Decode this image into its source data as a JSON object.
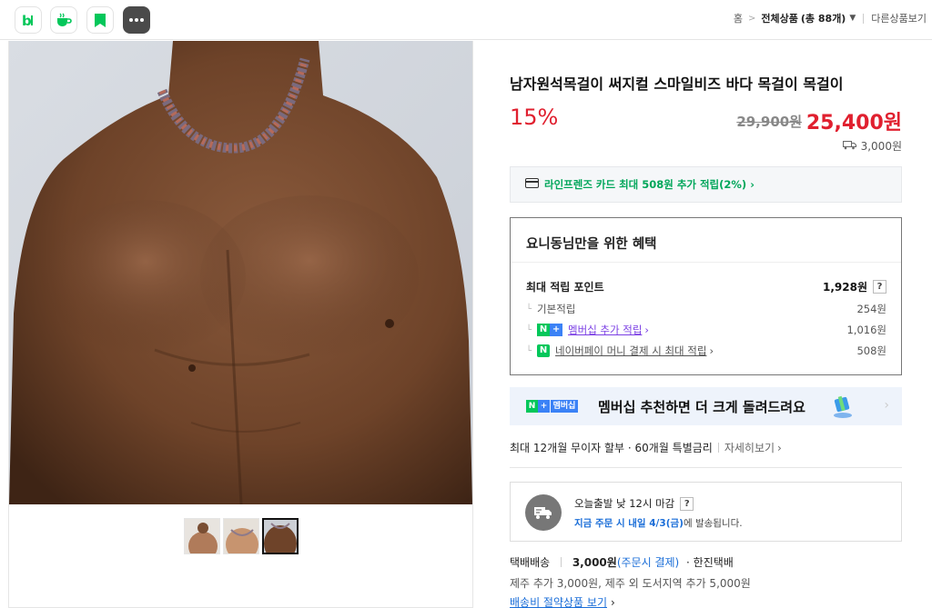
{
  "topbar": {
    "icons": [
      "blog-icon",
      "cafe-icon",
      "bookmark-icon",
      "more-icon"
    ],
    "breadcrumb": {
      "home": "홈",
      "category": "전체상품",
      "count": "(총 88개)",
      "other": "다른상품보기"
    }
  },
  "product": {
    "title": "남자원석목걸이 써지컬 스마일비즈 바다 목걸이 목걸이",
    "discount": "15%",
    "original_price": "29,900원",
    "price": "25,400원",
    "shipping_fee": "3,000원"
  },
  "card_promo": "라인프렌즈 카드 최대 508원 추가 적립(2%)",
  "benefits": {
    "title": "요니동님만을 위한 혜택",
    "max_points_label": "최대 적립 포인트",
    "max_points_value": "1,928원",
    "basic_label": "기본적립",
    "basic_value": "254원",
    "membership_label": "멤버십 추가 적립",
    "membership_value": "1,016원",
    "naverpay_label": "네이버페이 머니 결제 시 최대 적립",
    "naverpay_value": "508원"
  },
  "banner": {
    "badge": "멤버십",
    "text": "멤버십 추천하면 더 크게 돌려드려요"
  },
  "installment": {
    "text": "최대 12개월 무이자 할부 · 60개월 특별금리",
    "more": "자세히보기"
  },
  "delivery": {
    "cutoff": "오늘출발 낮 12시 마감",
    "notice_blue": "지금 주문 시 내일 4/3(금)",
    "notice_rest": "에 발송됩니다."
  },
  "shipping": {
    "method": "택배배송",
    "fee": "3,000원",
    "fee_note": "(주문시 결제)",
    "carrier": "· 한진택배",
    "extra": "제주 추가 3,000원, 제주 외 도서지역 추가 5,000원",
    "saving_link": "배송비 절약상품 보기"
  },
  "colors": {
    "sale_red": "#e0202f",
    "naver_green": "#03c75a",
    "link_blue": "#1b6ed8",
    "membership_purple": "#7b3fe4"
  }
}
